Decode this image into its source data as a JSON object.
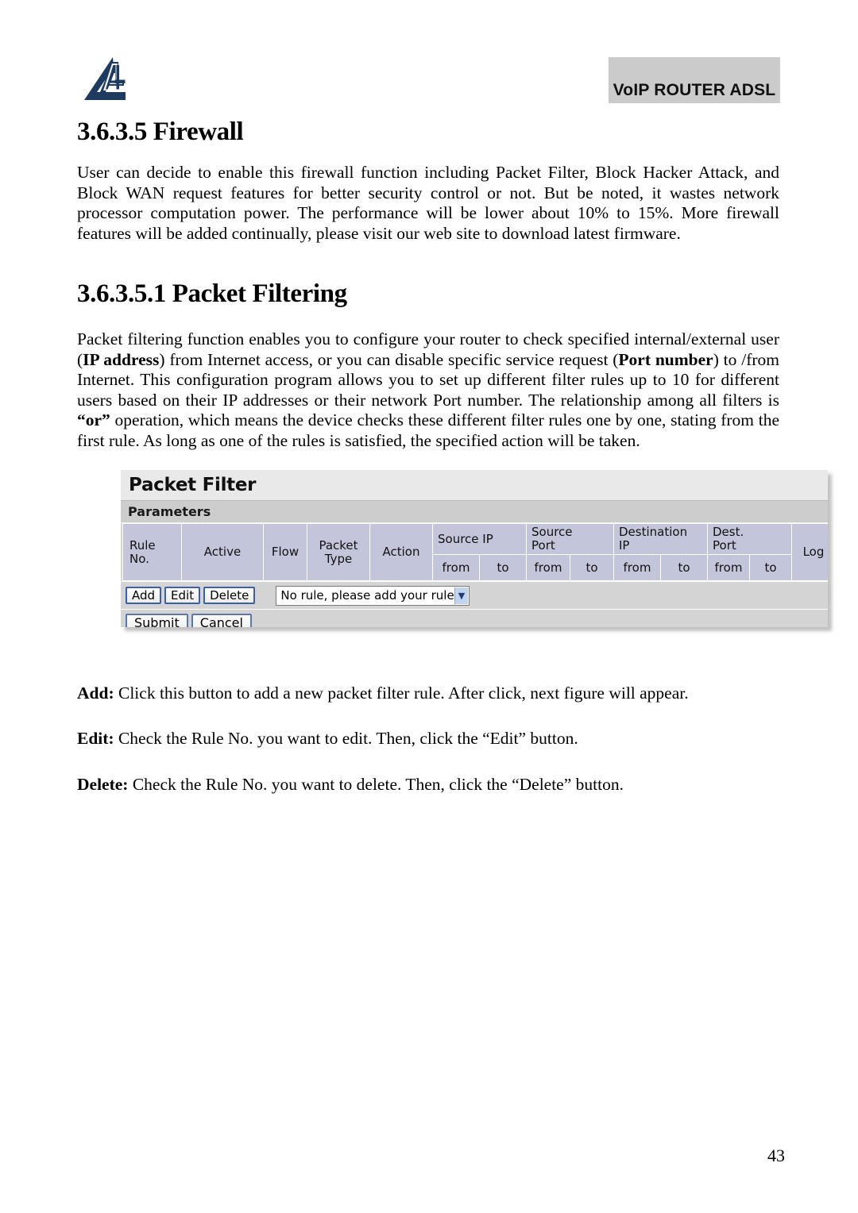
{
  "header": {
    "logo_icon": "atlantis-triangle-a-logo-icon",
    "product_badge": "VoIP ROUTER ADSL"
  },
  "sections": {
    "firewall": {
      "heading": "3.6.3.5 Firewall",
      "paragraph": "User can decide to enable this firewall function including Packet Filter, Block Hacker Attack, and Block WAN request features for better security control or not. But be noted, it wastes network processor computation power. The performance will be lower about 10% to 15%. More firewall features will be added continually, please visit our web site to download latest firmware."
    },
    "packet_filtering": {
      "heading": "3.6.3.5.1 Packet Filtering",
      "paragraph_part1": "Packet filtering function enables you to configure your router to check specified internal/external user (",
      "term_ip_address": "IP address",
      "paragraph_part2": ") from Internet access, or you can disable specific service request (",
      "term_port_number": "Port number",
      "paragraph_part3": ") to /from Internet. This configuration program allows you to set up different filter rules up to 10 for different users based on their IP addresses or their network Port number. The relationship among all filters is ",
      "term_or": "“or”",
      "paragraph_part4": " operation, which means the device checks these different filter rules one by one, stating from the first rule. As long as one of the rules is satisfied, the specified action will be taken."
    }
  },
  "ui_figure": {
    "title": "Packet Filter",
    "subbar": "Parameters",
    "table": {
      "columns_top": [
        {
          "label": "Rule\nNo.",
          "span": 1,
          "rows": 2
        },
        {
          "label": "Active",
          "span": 1,
          "rows": 2
        },
        {
          "label": "Flow",
          "span": 1,
          "rows": 2
        },
        {
          "label": "Packet\nType",
          "span": 1,
          "rows": 2
        },
        {
          "label": "Action",
          "span": 1,
          "rows": 2
        },
        {
          "label": "Source IP",
          "span": 2,
          "rows": 1
        },
        {
          "label": "Source Port",
          "span": 2,
          "rows": 1
        },
        {
          "label": "Destination IP",
          "span": 2,
          "rows": 1
        },
        {
          "label": "Dest. Port",
          "span": 2,
          "rows": 1
        },
        {
          "label": "Log",
          "span": 1,
          "rows": 2
        },
        {
          "label": "Rule\nNo.",
          "span": 1,
          "rows": 2
        }
      ],
      "headers_simple": {
        "rule_no": "Rule No.",
        "rule_no_l1": "Rule",
        "rule_no_l2": "No.",
        "active": "Active",
        "flow": "Flow",
        "packet_type_l1": "Packet",
        "packet_type_l2": "Type",
        "action": "Action",
        "source_ip": "Source IP",
        "source_port_l1": "Source",
        "source_port_l2": "Port",
        "destination_ip_l1": "Destination",
        "destination_ip_l2": "IP",
        "dest_port_l1": "Dest.",
        "dest_port_l2": "Port",
        "log": "Log"
      },
      "subheaders": {
        "from": "from",
        "to": "to"
      }
    },
    "buttons": {
      "add": "Add",
      "edit": "Edit",
      "delete": "Delete",
      "submit": "Submit",
      "cancel": "Cancel"
    },
    "rule_select": {
      "value": "No rule, please add your rule",
      "arrow_icon": "chevron-down-icon"
    }
  },
  "notes": {
    "add_term": "Add:",
    "add_text": " Click this button to add a new packet filter rule. After click, next figure will appear.",
    "edit_term": "Edit:",
    "edit_text": " Check the Rule No. you want to edit. Then, click the “Edit” button.",
    "delete_term": "Delete:",
    "delete_text": " Check the Rule No. you want to delete. Then, click the “Delete” button."
  },
  "footer": {
    "page_number": "43"
  },
  "colors": {
    "logo_navy": "#1f3a5f",
    "badge_gray": "#cbcbcb",
    "ui_bg_gray": "#d4d4d4",
    "table_header_lavender": "#c3c6da",
    "button_border_blue": "#3b5fa8"
  }
}
